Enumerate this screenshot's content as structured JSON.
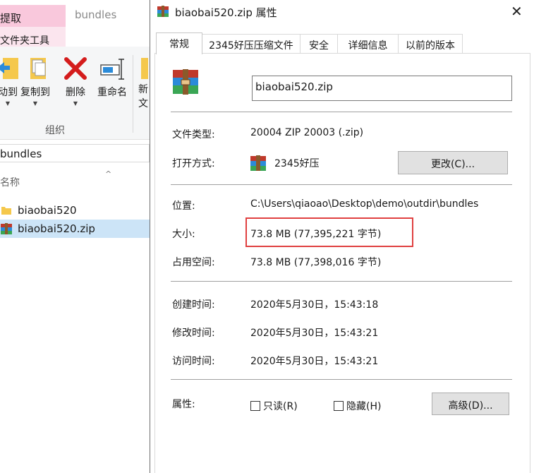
{
  "explorer": {
    "ribbon": {
      "tab_extract": "提取",
      "tab_bundles": "bundles",
      "sub_tab": "文件夹工具",
      "buttons": [
        {
          "label": "动到"
        },
        {
          "label": "复制到"
        },
        {
          "label": "删除"
        },
        {
          "label": "重命名"
        },
        {
          "label": "新"
        }
      ],
      "extra_char": "文",
      "group_label": "组织"
    },
    "address": "bundles",
    "column_header": "名称",
    "files": [
      {
        "name": "biaobai520",
        "type": "folder"
      },
      {
        "name": "biaobai520.zip",
        "type": "zip",
        "selected": true
      }
    ]
  },
  "dialog": {
    "title": "biaobai520.zip 属性",
    "close_glyph": "✕",
    "tabs": [
      "常规",
      "2345好压压缩文件",
      "安全",
      "详细信息",
      "以前的版本"
    ],
    "file_name": "biaobai520.zip",
    "rows": {
      "file_type": {
        "label": "文件类型:",
        "value": "20004 ZIP 20003 (.zip)"
      },
      "open_with": {
        "label": "打开方式:",
        "value": "2345好压",
        "button": "更改(C)..."
      },
      "location": {
        "label": "位置:",
        "value": "C:\\Users\\qiaoao\\Desktop\\demo\\outdir\\bundles"
      },
      "size": {
        "label": "大小:",
        "value": "73.8 MB (77,395,221 字节)"
      },
      "size_on_disk": {
        "label": "占用空间:",
        "value": "73.8 MB (77,398,016 字节)"
      },
      "created": {
        "label": "创建时间:",
        "value": "2020年5月30日，15:43:18"
      },
      "modified": {
        "label": "修改时间:",
        "value": "2020年5月30日，15:43:21"
      },
      "accessed": {
        "label": "访问时间:",
        "value": "2020年5月30日，15:43:21"
      }
    },
    "attributes": {
      "label": "属性:",
      "readonly": "只读(R)",
      "hidden": "隐藏(H)",
      "advanced": "高级(D)..."
    }
  },
  "colors": {
    "tab_extract_bg": "#f9c8dc",
    "selected_row": "#cce4f7",
    "highlight_border": "#e04040",
    "button_bg": "#e1e1e1"
  }
}
